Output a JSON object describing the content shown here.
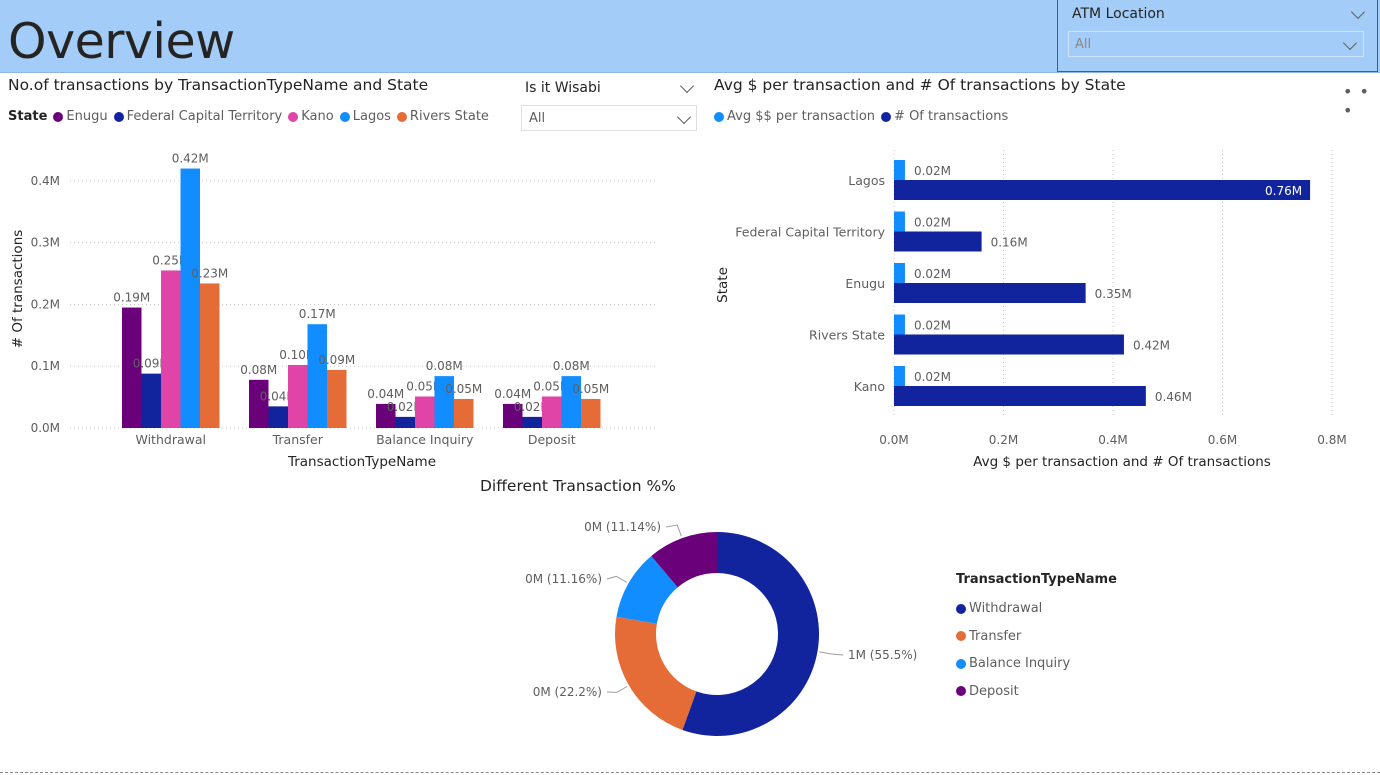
{
  "page": {
    "title": "Overview"
  },
  "slicers": {
    "atm": {
      "title": "ATM Location",
      "value": "All"
    },
    "wisabi": {
      "title": "Is it Wisabi",
      "value": "All"
    }
  },
  "colors": {
    "enugu": "#6b007b",
    "fct": "#12239e",
    "kano": "#e044a7",
    "lagos": "#118dff",
    "rivers": "#e66c37",
    "avg": "#118dff",
    "count": "#12239e"
  },
  "chart_data": [
    {
      "type": "bar",
      "title": "No.of transactions by TransactionTypeName and State",
      "legend_title": "State",
      "xlabel": "TransactionTypeName",
      "ylabel": "# Of transactions",
      "ylim": [
        0,
        0.45
      ],
      "y_ticks": [
        "0.0M",
        "0.1M",
        "0.2M",
        "0.3M",
        "0.4M"
      ],
      "categories": [
        "Withdrawal",
        "Transfer",
        "Balance Inquiry",
        "Deposit"
      ],
      "series": [
        {
          "name": "Enugu",
          "values": [
            0.195,
            0.078,
            0.039,
            0.039
          ],
          "labels": [
            "0.19M",
            "0.08M",
            "0.04M",
            "0.04M"
          ]
        },
        {
          "name": "Federal Capital Territory",
          "values": [
            0.088,
            0.035,
            0.018,
            0.018
          ],
          "labels": [
            "0.09M",
            "0.04M",
            "0.02M",
            "0.02M"
          ]
        },
        {
          "name": "Kano",
          "values": [
            0.255,
            0.102,
            0.051,
            0.051
          ],
          "labels": [
            "0.25M",
            "0.10M",
            "0.05M",
            "0.05M"
          ]
        },
        {
          "name": "Lagos",
          "values": [
            0.42,
            0.168,
            0.084,
            0.084
          ],
          "labels": [
            "0.42M",
            "0.17M",
            "0.08M",
            "0.08M"
          ]
        },
        {
          "name": "Rivers State",
          "values": [
            0.234,
            0.094,
            0.047,
            0.047
          ],
          "labels": [
            "0.23M",
            "0.09M",
            "0.05M",
            "0.05M"
          ]
        }
      ],
      "grid": true,
      "legend_position": "top-left"
    },
    {
      "type": "bar",
      "orientation": "horizontal",
      "title": "Avg $ per transaction and # Of transactions by State",
      "xlabel": "Avg $ per transaction and # Of transactions",
      "ylabel": "State",
      "xlim": [
        0,
        0.8
      ],
      "x_ticks": [
        "0.0M",
        "0.2M",
        "0.4M",
        "0.6M",
        "0.8M"
      ],
      "categories": [
        "Lagos",
        "Federal Capital Territory",
        "Enugu",
        "Rivers State",
        "Kano"
      ],
      "series": [
        {
          "name": "Avg $$ per transaction",
          "values": [
            0.02,
            0.02,
            0.02,
            0.02,
            0.02
          ],
          "labels": [
            "0.02M",
            "0.02M",
            "0.02M",
            "0.02M",
            "0.02M"
          ]
        },
        {
          "name": "# Of transactions",
          "values": [
            0.76,
            0.16,
            0.35,
            0.42,
            0.46
          ],
          "labels": [
            "0.76M",
            "0.16M",
            "0.35M",
            "0.42M",
            "0.46M"
          ]
        }
      ],
      "grid": true,
      "legend_position": "top-left"
    },
    {
      "type": "pie",
      "donut": true,
      "title": "Different Transaction %%",
      "legend_title": "TransactionTypeName",
      "categories": [
        "Withdrawal",
        "Transfer",
        "Balance Inquiry",
        "Deposit"
      ],
      "values": [
        55.5,
        22.2,
        11.16,
        11.14
      ],
      "labels": [
        "1M (55.5%)",
        "0M (22.2%)",
        "0M (11.16%)",
        "0M (11.14%)"
      ],
      "legend_position": "right"
    }
  ]
}
